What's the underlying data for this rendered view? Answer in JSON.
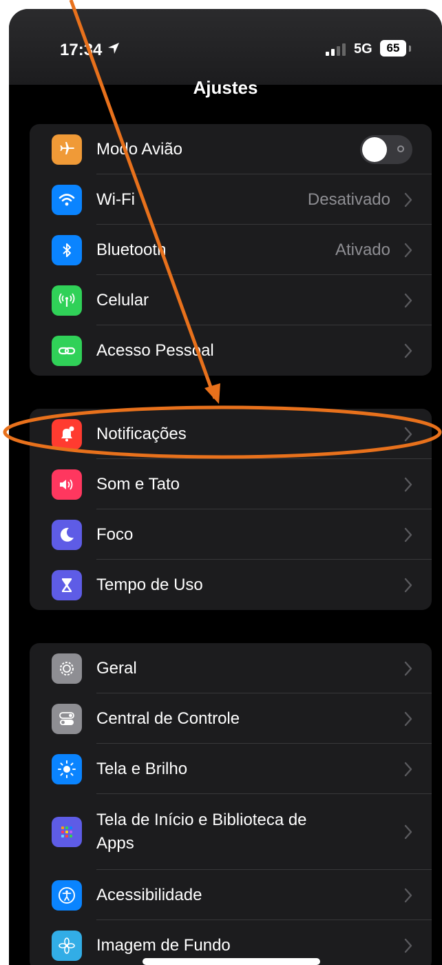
{
  "status_bar": {
    "time": "17:34",
    "network": "5G",
    "battery": "65"
  },
  "header": {
    "title": "Ajustes"
  },
  "groups": [
    {
      "items": [
        {
          "label": "Modo Avião",
          "icon": "airplane-icon",
          "color": "#f09a37",
          "toggle": false
        },
        {
          "label": "Wi-Fi",
          "value": "Desativado",
          "icon": "wifi-icon",
          "color": "#0a84ff"
        },
        {
          "label": "Bluetooth",
          "value": "Ativado",
          "icon": "bluetooth-icon",
          "color": "#0a84ff"
        },
        {
          "label": "Celular",
          "icon": "antenna-icon",
          "color": "#30d158"
        },
        {
          "label": "Acesso Pessoal",
          "icon": "link-icon",
          "color": "#30d158"
        }
      ]
    },
    {
      "items": [
        {
          "label": "Notificações",
          "icon": "notification-bell-icon",
          "color": "#ff3b30"
        },
        {
          "label": "Som e Tato",
          "icon": "speaker-icon",
          "color": "#ff375f"
        },
        {
          "label": "Foco",
          "icon": "moon-icon",
          "color": "#5e5ce6"
        },
        {
          "label": "Tempo de Uso",
          "icon": "hourglass-icon",
          "color": "#5e5ce6"
        }
      ]
    },
    {
      "items": [
        {
          "label": "Geral",
          "icon": "gear-icon",
          "color": "#8e8e93"
        },
        {
          "label": "Central de Controle",
          "icon": "switches-icon",
          "color": "#8e8e93"
        },
        {
          "label": "Tela e Brilho",
          "icon": "sun-icon",
          "color": "#0a84ff"
        },
        {
          "label": "Tela de Início e Biblioteca de Apps",
          "icon": "app-grid-icon",
          "color": "#5e5ce6"
        },
        {
          "label": "Acessibilidade",
          "icon": "accessibility-icon",
          "color": "#0a84ff"
        },
        {
          "label": "Imagem de Fundo",
          "icon": "flower-icon",
          "color": "#32ade6"
        }
      ]
    }
  ],
  "annotation": {
    "color": "#e8711c",
    "highlighted_item": "Notificações"
  }
}
